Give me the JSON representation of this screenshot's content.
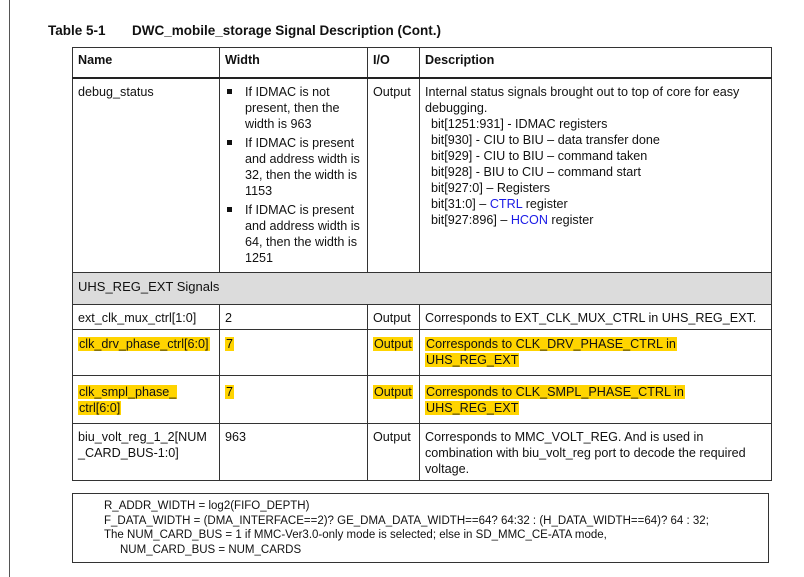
{
  "caption": {
    "number": "Table 5-1",
    "title": "DWC_mobile_storage Signal Description (Cont.)"
  },
  "headers": [
    "Name",
    "Width",
    "I/O",
    "Description"
  ],
  "debug_row": {
    "name": "debug_status",
    "width_bullets": [
      "If IDMAC is not present, then the width is 963",
      "If IDMAC is present and address width is 32, then the width is 1153",
      "If IDMAC is present and address width is 64, then the width is 1251"
    ],
    "io": "Output",
    "desc_intro": "Internal status signals brought out to top of core for easy debugging.",
    "desc_lines": [
      "bit[1251:931] - IDMAC registers",
      "bit[930] - CIU to BIU – data transfer done",
      "bit[929] - CIU to BIU – command taken",
      "bit[928] - BIU to CIU – command start",
      "bit[927:0] – Registers"
    ],
    "ctrl_line": {
      "prefix": "bit[31:0] – ",
      "link": "CTRL",
      "suffix": " register"
    },
    "hcon_line": {
      "prefix": "bit[927:896] – ",
      "link": "HCON",
      "suffix": " register"
    }
  },
  "section": "UHS_REG_EXT Signals",
  "rows": [
    {
      "name": "ext_clk_mux_ctrl[1:0]",
      "width": "2",
      "io": "Output",
      "desc": "Corresponds to EXT_CLK_MUX_CTRL in UHS_REG_EXT."
    },
    {
      "name": "clk_drv_phase_ctrl[6:0]",
      "width": "7",
      "io": "Output",
      "desc_1": "Corresponds to CLK_DRV_PHASE_CTRL in",
      "desc_2": "UHS_REG_EXT"
    },
    {
      "name_1": "clk_smpl_phase_",
      "name_2": "ctrl[6:0]",
      "width": "7",
      "io": "Output",
      "desc_1": "Corresponds to CLK_SMPL_PHASE_CTRL in",
      "desc_2": "UHS_REG_EXT"
    },
    {
      "name_1": "biu_volt_reg_1_2[NUM",
      "name_2": "_CARD_BUS-1:0]",
      "width": "963",
      "io": "Output",
      "desc": "Corresponds to MMC_VOLT_REG. And is used in combination with biu_volt_reg port to decode the required voltage."
    }
  ],
  "highlight_color": "#ffd400",
  "link_color": "#1a1ae6",
  "notes": [
    "R_ADDR_WIDTH = log2(FIFO_DEPTH)",
    "F_DATA_WIDTH = (DMA_INTERFACE==2)? GE_DMA_DATA_WIDTH==64? 64:32 : (H_DATA_WIDTH==64)? 64 : 32;",
    "The NUM_CARD_BUS = 1 if MMC-Ver3.0-only mode is selected; else in SD_MMC_CE-ATA mode,",
    "NUM_CARD_BUS = NUM_CARDS"
  ]
}
